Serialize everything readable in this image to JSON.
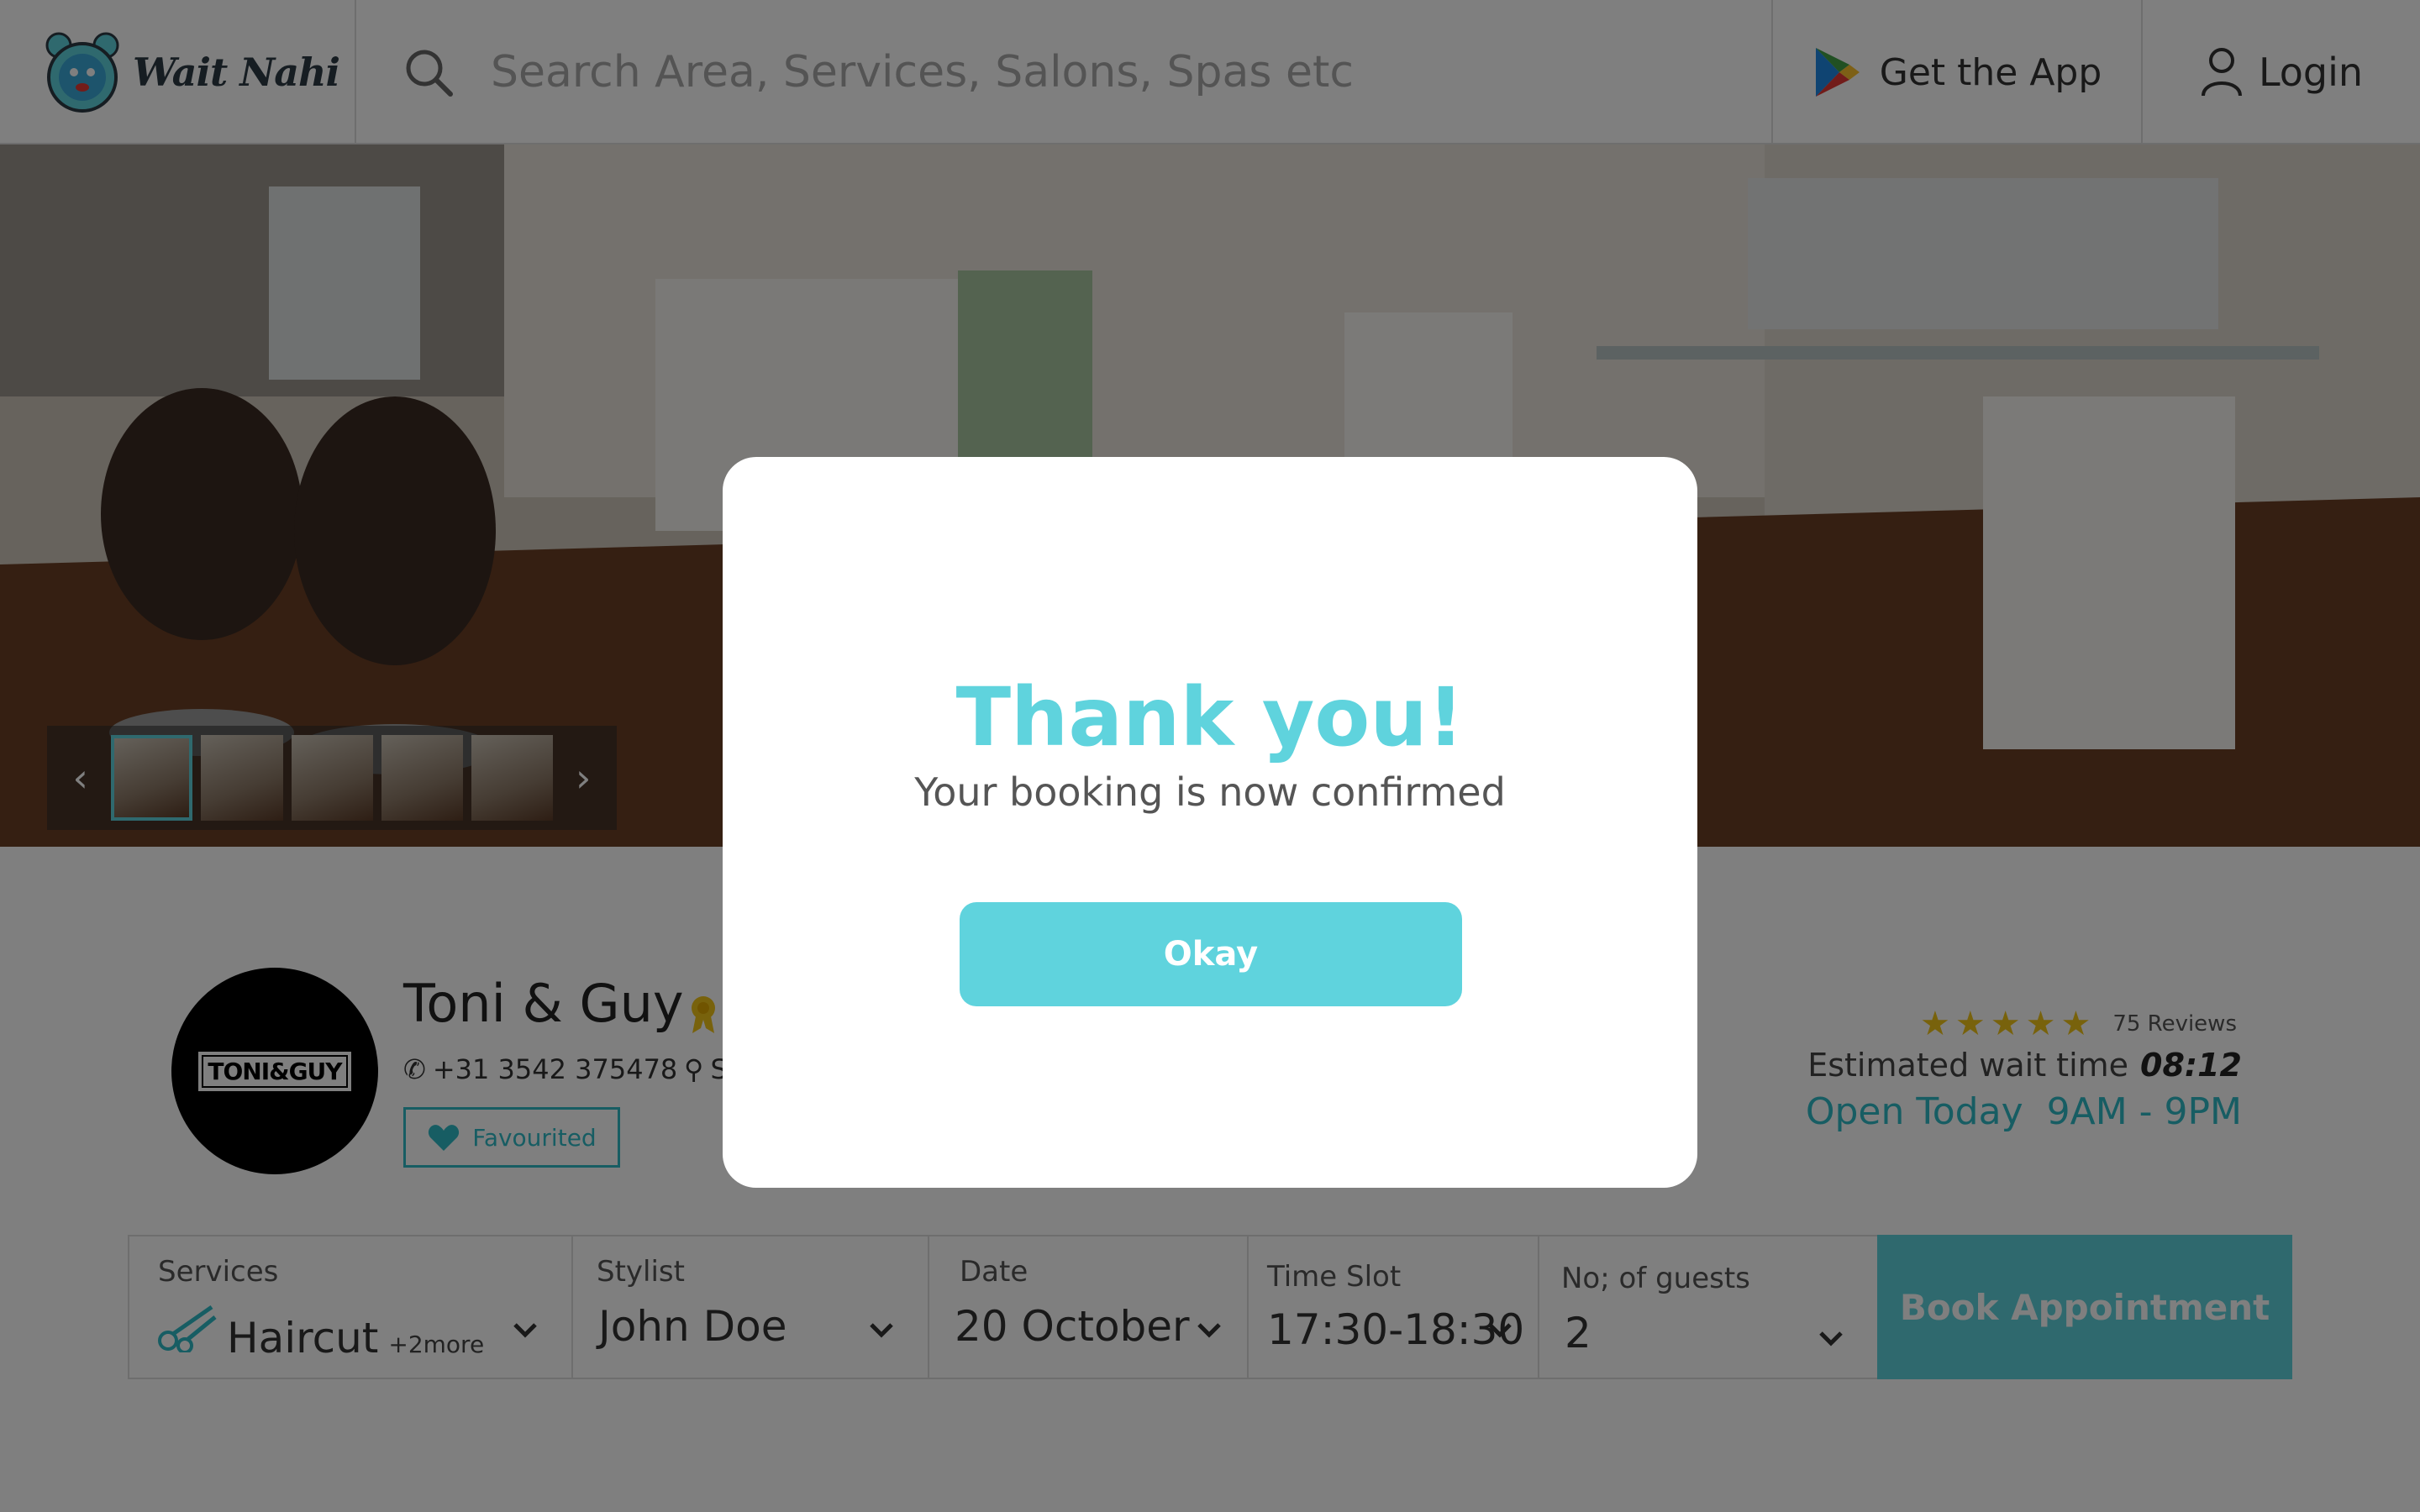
{
  "header": {
    "brand": "Wait Nahi",
    "search_placeholder": "Search Area, Services, Salons, Spas etc",
    "get_app_label": "Get the App",
    "login_label": "Login"
  },
  "gallery": {
    "thumbnail_count": 5,
    "active_index": 0
  },
  "salon": {
    "name": "Toni & Guy",
    "logo_text": "TONI&GUY",
    "phone": "+31 3542 375478",
    "address": "S",
    "favourite_label": "Favourited",
    "rating_stars": 5,
    "reviews": "75 Reviews",
    "wait_label": "Estimated wait time",
    "wait_value": "08:12",
    "open_label": "Open Today",
    "open_hours": "9AM -  9PM"
  },
  "booking": {
    "services_label": "Services",
    "services_value": "Haircut",
    "services_more": "+2more",
    "stylist_label": "Stylist",
    "stylist_value": "John Doe",
    "date_label": "Date",
    "date_value": "20 October",
    "timeslot_label": "Time Slot",
    "timeslot_value": "17:30-18:30",
    "guests_label": "No; of guests",
    "guests_value": "2",
    "book_label": "Book Appointment"
  },
  "modal": {
    "title": "Thank you!",
    "subtitle": "Your booking is now confirmed",
    "okay_label": "Okay"
  },
  "colors": {
    "accent": "#5fd3dd",
    "accent_dark": "#2fbac6",
    "star": "#f0c419",
    "overlay": "rgba(0,0,0,0.5)"
  }
}
